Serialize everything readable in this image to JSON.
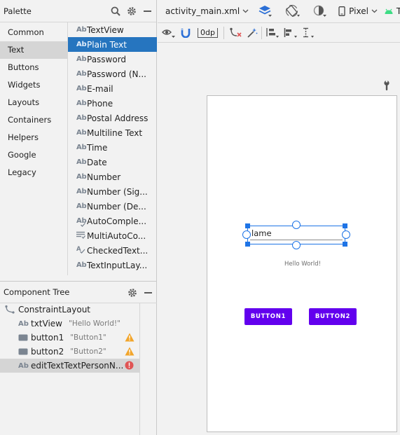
{
  "palette": {
    "title": "Palette",
    "categories": [
      "Common",
      "Text",
      "Buttons",
      "Widgets",
      "Layouts",
      "Containers",
      "Helpers",
      "Google",
      "Legacy"
    ],
    "selected_category": "Text",
    "items": [
      {
        "label": "TextView",
        "icon": "Ab"
      },
      {
        "label": "Plain Text",
        "icon": "Ab"
      },
      {
        "label": "Password",
        "icon": "Ab"
      },
      {
        "label": "Password (N...",
        "icon": "Ab"
      },
      {
        "label": "E-mail",
        "icon": "Ab"
      },
      {
        "label": "Phone",
        "icon": "Ab"
      },
      {
        "label": "Postal Address",
        "icon": "Ab"
      },
      {
        "label": "Multiline Text",
        "icon": "Ab"
      },
      {
        "label": "Time",
        "icon": "Ab"
      },
      {
        "label": "Date",
        "icon": "Ab"
      },
      {
        "label": "Number",
        "icon": "Ab"
      },
      {
        "label": "Number (Sig...",
        "icon": "Ab"
      },
      {
        "label": "Number (De...",
        "icon": "Ab"
      },
      {
        "label": "AutoComple...",
        "icon": "Ab"
      },
      {
        "label": "MultiAutoCo...",
        "icon": "list-icon"
      },
      {
        "label": "CheckedText...",
        "icon": "A-check"
      },
      {
        "label": "TextInputLay...",
        "icon": "Ab"
      }
    ],
    "selected_item": "Plain Text"
  },
  "component_tree": {
    "title": "Component Tree",
    "root": "ConstraintLayout",
    "nodes": [
      {
        "name": "txtView",
        "hint": "\"Hello World!\"",
        "icon": "Ab",
        "status": ""
      },
      {
        "name": "button1",
        "hint": "\"Button1\"",
        "icon": "button-icon",
        "status": "warning"
      },
      {
        "name": "button2",
        "hint": "\"Button2\"",
        "icon": "button-icon",
        "status": "warning"
      },
      {
        "name": "editTextTextPersonN...",
        "hint": "",
        "icon": "Ab",
        "status": "error"
      }
    ]
  },
  "toolbar": {
    "file_name": "activity_main.xml",
    "device": "Pixel",
    "api": "T",
    "margin": "0dp"
  },
  "preview": {
    "edit_text": "Name",
    "edit_text_visible": "lame",
    "hello": "Hello World!",
    "button1": "BUTTON1",
    "button2": "BUTTON2"
  },
  "colors": {
    "accent": "#2675bf",
    "button": "#6200ee",
    "warning": "#f2a52b",
    "error": "#e05555",
    "handle": "#1e74e6"
  }
}
